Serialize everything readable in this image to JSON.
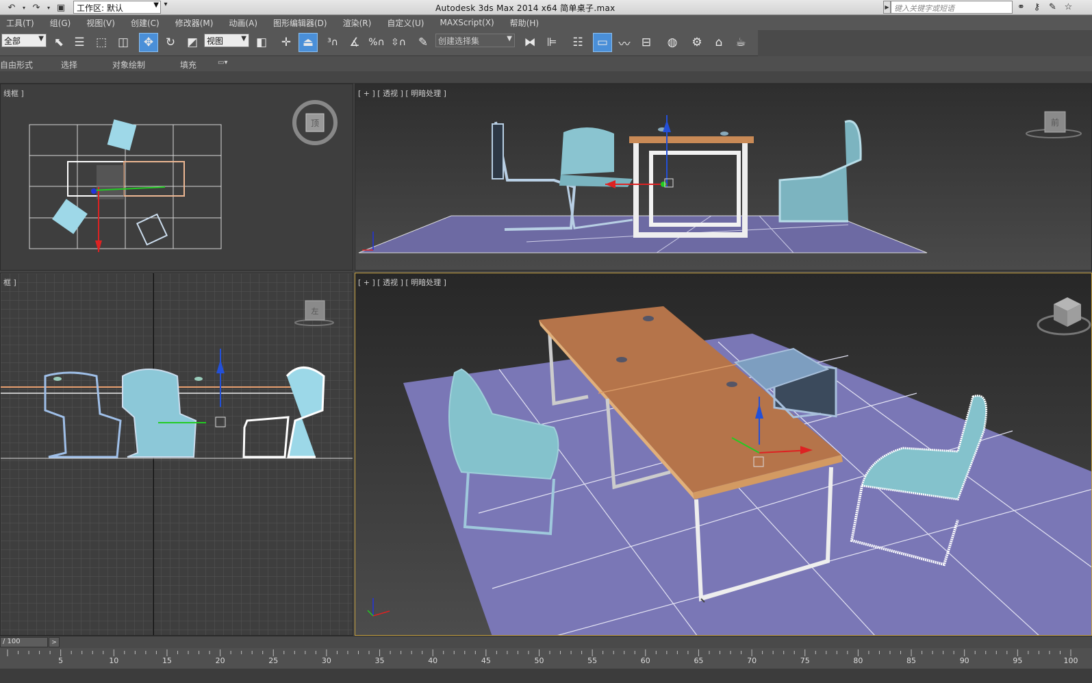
{
  "titlebar": {
    "workspace": "工作区: 默认",
    "app_title": "Autodesk 3ds Max  2014 x64      简单桌子.max",
    "search_placeholder": "键入关键字或短语"
  },
  "menu": [
    "工具(T)",
    "组(G)",
    "视图(V)",
    "创建(C)",
    "修改器(M)",
    "动画(A)",
    "图形编辑器(D)",
    "渲染(R)",
    "自定义(U)",
    "MAXScript(X)",
    "帮助(H)"
  ],
  "toolbar": {
    "selection_filter": "全部",
    "ref_coord": "视图",
    "named_selection": "创建选择集"
  },
  "ribbon": {
    "tabs": [
      "自由形式",
      "选择",
      "对象绘制",
      "填充"
    ]
  },
  "viewports": {
    "top_label": "线框 ]",
    "front_label": "[ + ] [ 透视 ] [ 明暗处理 ]",
    "left_label": "框 ]",
    "persp_label": "[ + ] [ 透视 ] [ 明暗处理 ]",
    "cube_top": "顶",
    "cube_front": "前",
    "cube_left": "左"
  },
  "timeline": {
    "frame": "/ 100",
    "ticks": [
      "5",
      "10",
      "15",
      "20",
      "25",
      "30",
      "35",
      "40",
      "45",
      "50",
      "55",
      "60",
      "65",
      "70",
      "75",
      "80",
      "85",
      "90",
      "95",
      "100"
    ]
  },
  "colors": {
    "accent_active": "#4a8fd8",
    "viewport_active_border": "#c8a240",
    "floor": "#7777b8",
    "table_top": "#b5744a",
    "chair": "#7ab8c8"
  }
}
